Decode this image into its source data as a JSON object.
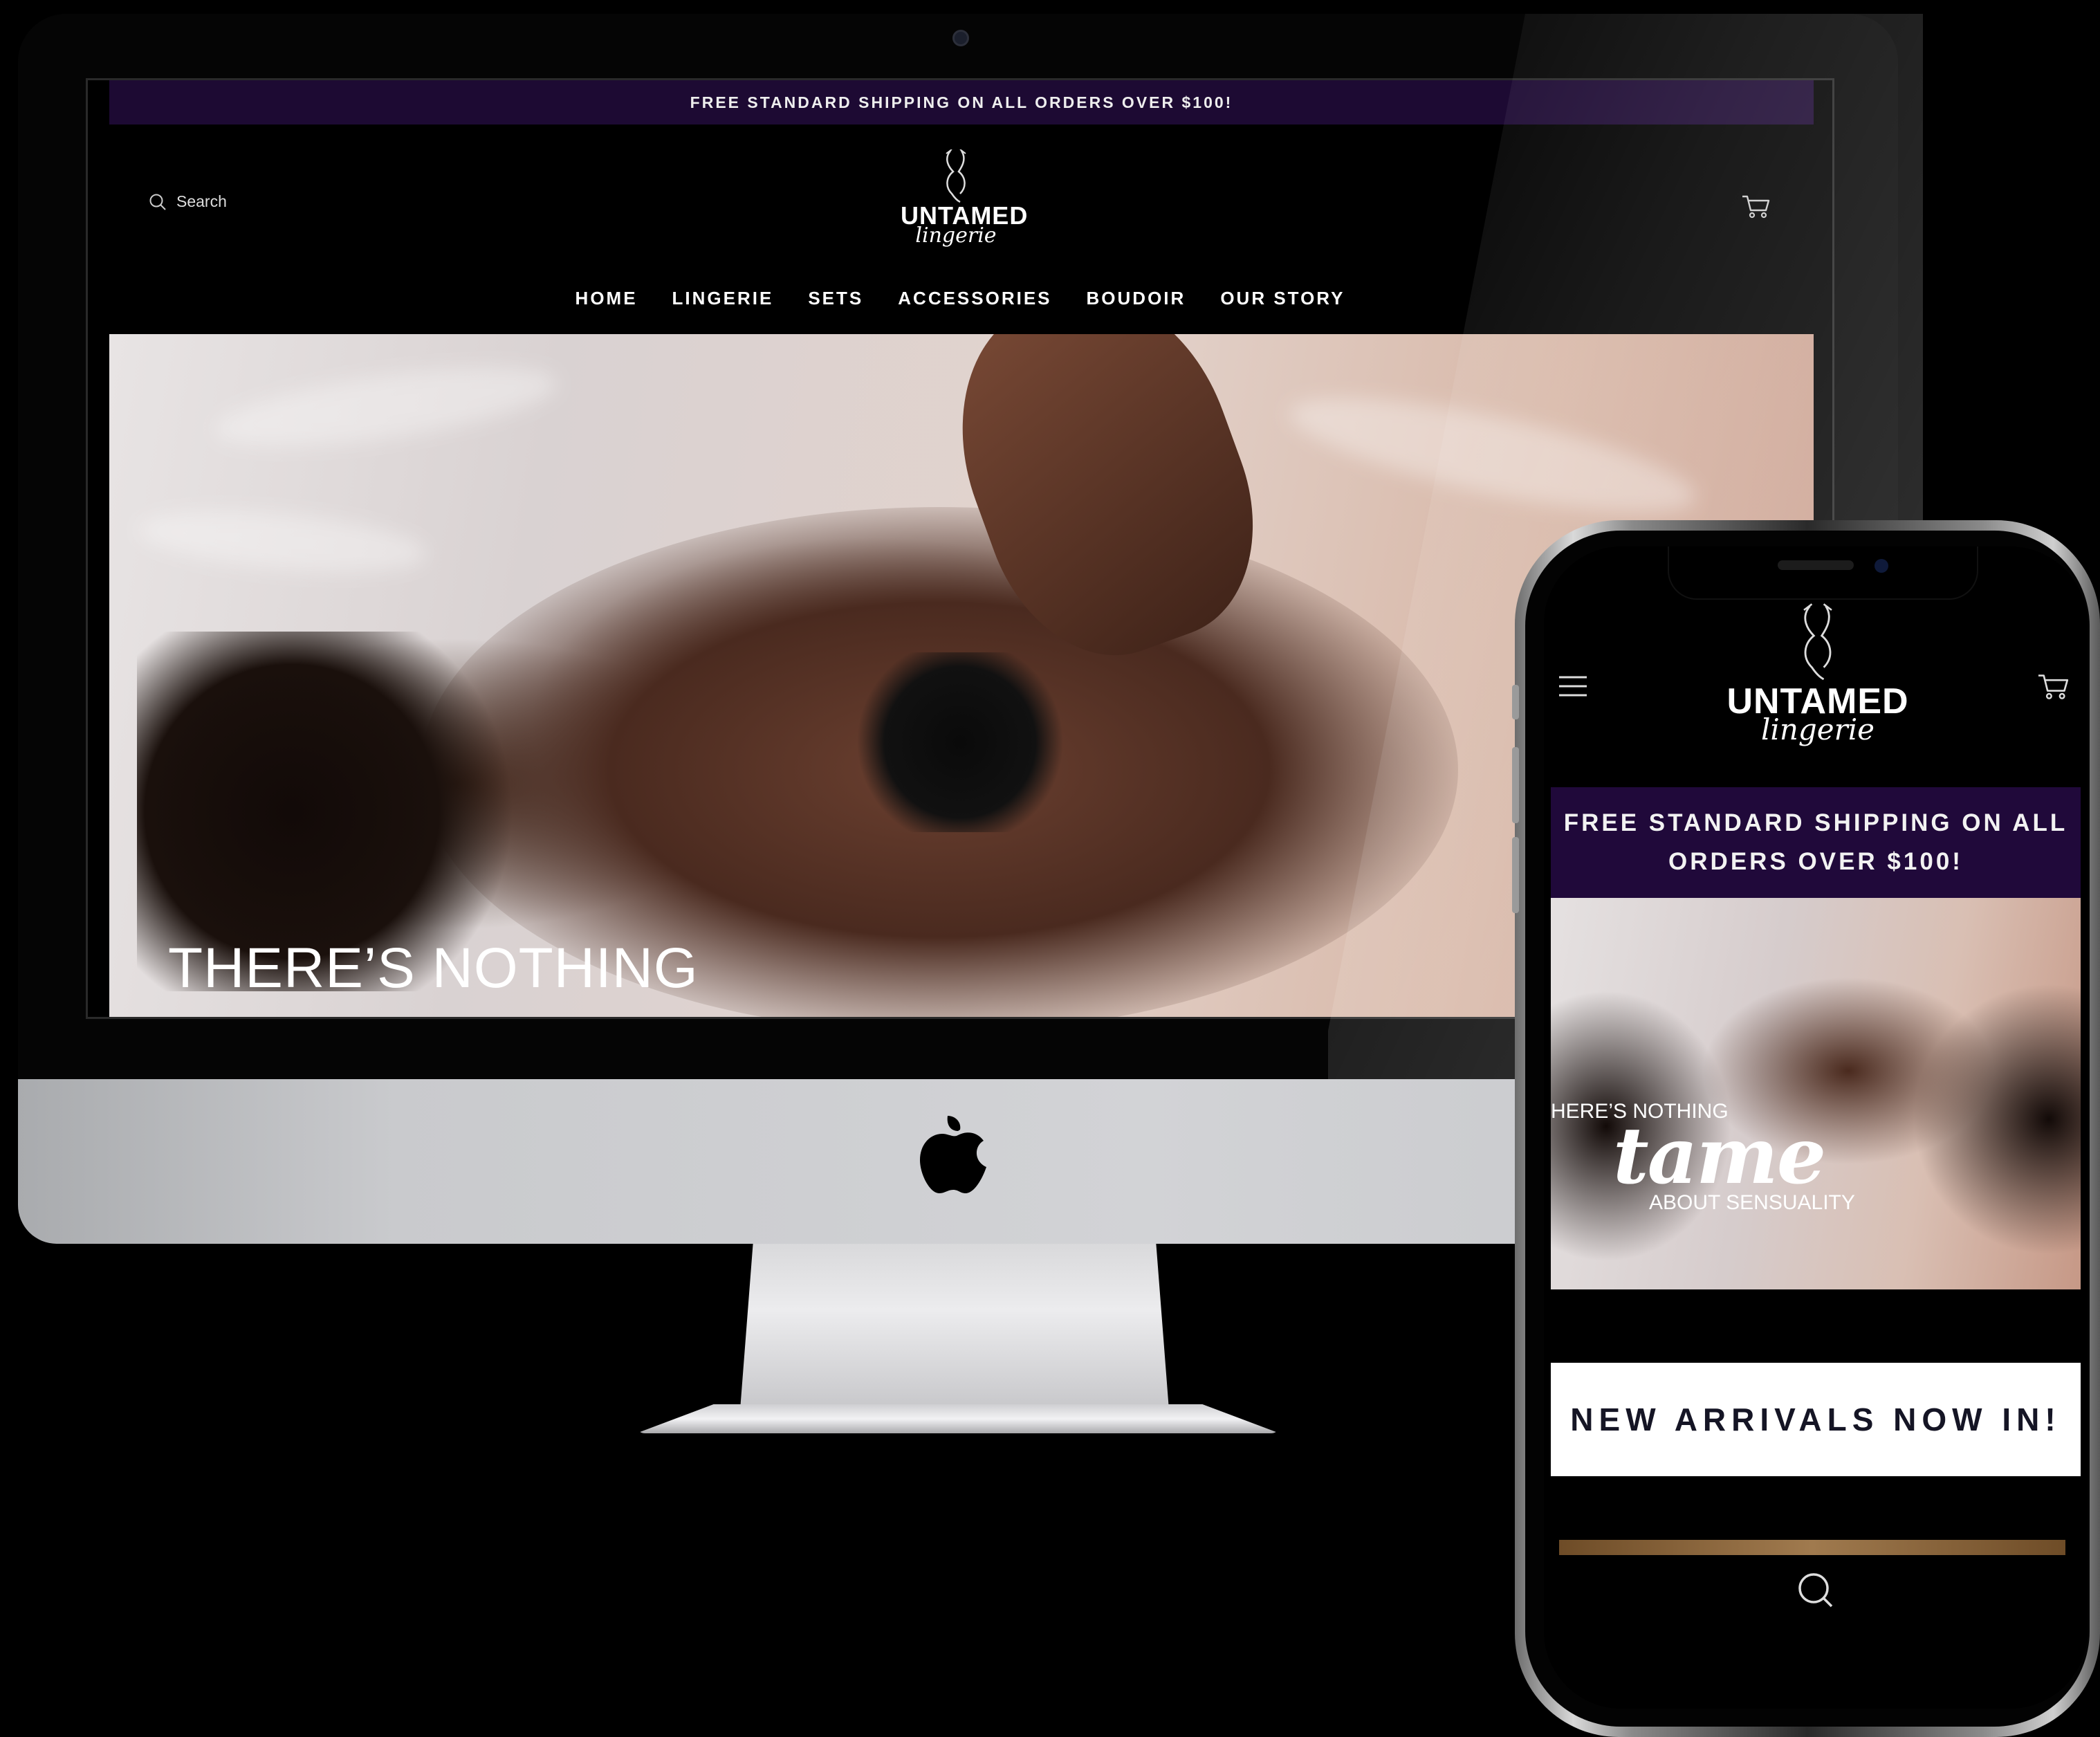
{
  "desktop": {
    "promo": "FREE STANDARD SHIPPING ON ALL ORDERS OVER $100!",
    "search_label": "Search",
    "logo": {
      "main": "UNTAMED",
      "script": "lingerie"
    },
    "nav": [
      "HOME",
      "LINGERIE",
      "SETS",
      "ACCESSORIES",
      "BOUDOIR",
      "OUR STORY"
    ],
    "hero_headline": "THERE’S NOTHING"
  },
  "mobile": {
    "logo": {
      "main": "UNTAMED",
      "script": "lingerie"
    },
    "promo": "FREE STANDARD SHIPPING ON ALL ORDERS OVER $100!",
    "hero": {
      "line1": "HERE’S NOTHING",
      "line2": "tame",
      "line3": "ABOUT SENSUALITY"
    },
    "banner": "NEW ARRIVALS NOW IN!"
  },
  "colors": {
    "promo_bg": "#1d0a33",
    "mobile_promo_bg": "#20093a",
    "page_bg": "#000000"
  },
  "icons": [
    "search-icon",
    "cart-icon",
    "hamburger-menu-icon",
    "apple-logo"
  ]
}
